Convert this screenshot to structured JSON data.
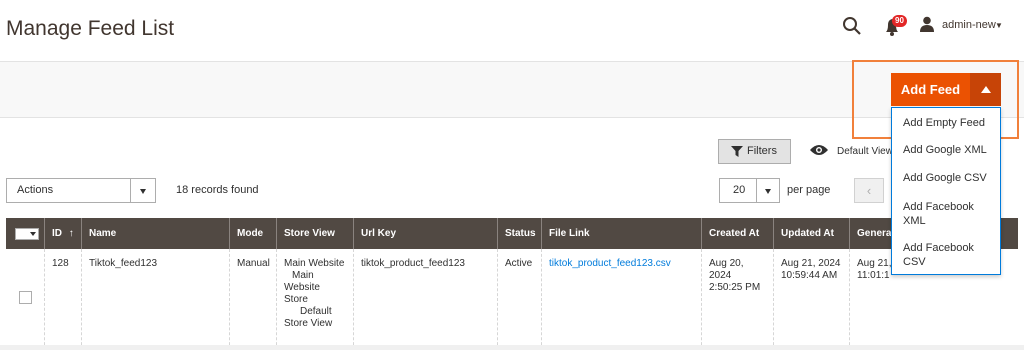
{
  "header": {
    "title": "Manage Feed List",
    "notifications_count": "90",
    "user_name": "admin-new"
  },
  "action_bar": {
    "add_feed_label": "Add Feed",
    "dropdown_items": [
      "Add Empty Feed",
      "Add Google XML",
      "Add Google CSV",
      "Add Facebook XML",
      "Add Facebook CSV"
    ]
  },
  "toolbar": {
    "filters_label": "Filters",
    "default_view_label": "Default View",
    "actions_label": "Actions",
    "records_found": "18 records found",
    "per_page_value": "20",
    "per_page_label": "per page",
    "prev_glyph": "‹"
  },
  "grid": {
    "columns": [
      "ID",
      "Name",
      "Mode",
      "Store View",
      "Url Key",
      "Status",
      "File Link",
      "Created At",
      "Updated At",
      "Genera"
    ],
    "sort_indicator": "↑",
    "rows": [
      {
        "id": "128",
        "name": "Tiktok_feed123",
        "mode": "Manual",
        "store_view": [
          "Main Website",
          "Main",
          "Website",
          "Store",
          "Default",
          "Store View"
        ],
        "url_key": "tiktok_product_feed123",
        "status": "Active",
        "file_link": "tiktok_product_feed123.csv",
        "created_at": [
          "Aug 20, 2024",
          "2:50:25 PM"
        ],
        "updated_at": [
          "Aug 21, 2024",
          "10:59:44 AM"
        ],
        "generated_at": [
          "Aug 21,",
          "11:01:1"
        ]
      }
    ]
  },
  "colors": {
    "accent": "#eb5202",
    "accent_dark": "#c74407",
    "header_bg": "#514943",
    "link": "#007bdb",
    "highlight": "#f1803b"
  }
}
